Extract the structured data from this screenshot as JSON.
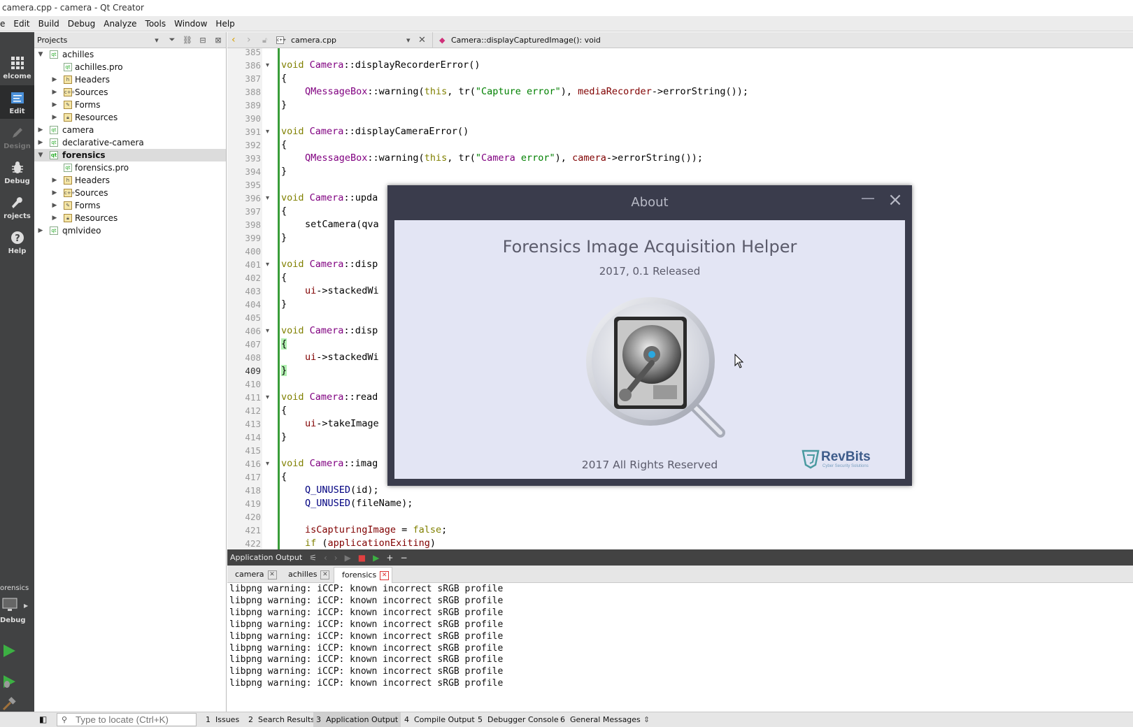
{
  "window": {
    "title": "camera.cpp - camera - Qt Creator"
  },
  "menu": [
    "e",
    "Edit",
    "Build",
    "Debug",
    "Analyze",
    "Tools",
    "Window",
    "Help"
  ],
  "modes": [
    {
      "label": "elcome",
      "icon": "grid-icon"
    },
    {
      "label": "Edit",
      "icon": "edit-icon"
    },
    {
      "label": "Design",
      "icon": "pencil-icon"
    },
    {
      "label": "Debug",
      "icon": "bug-icon"
    },
    {
      "label": "rojects",
      "icon": "wrench-icon"
    },
    {
      "label": "Help",
      "icon": "help-icon"
    }
  ],
  "kit": {
    "project": "orensics",
    "label": "Debug"
  },
  "projects": {
    "title": "Projects",
    "tree": [
      {
        "label": "achilles",
        "icon": "pro",
        "expanded": true
      },
      {
        "label": "achilles.pro",
        "icon": "profile"
      },
      {
        "label": "Headers",
        "icon": "h"
      },
      {
        "label": "Sources",
        "icon": "cpp"
      },
      {
        "label": "Forms",
        "icon": "form"
      },
      {
        "label": "Resources",
        "icon": "lock"
      },
      {
        "label": "camera",
        "icon": "pro"
      },
      {
        "label": "declarative-camera",
        "icon": "pro"
      },
      {
        "label": "forensics",
        "icon": "pro",
        "expanded": true,
        "selected": true
      },
      {
        "label": "forensics.pro",
        "icon": "profile"
      },
      {
        "label": "Headers",
        "icon": "h"
      },
      {
        "label": "Sources",
        "icon": "cpp"
      },
      {
        "label": "Forms",
        "icon": "form"
      },
      {
        "label": "Resources",
        "icon": "lock"
      },
      {
        "label": "qmlvideo",
        "icon": "pro"
      }
    ]
  },
  "editor": {
    "file": "camera.cpp",
    "function": "Camera::displayCapturedImage(): void",
    "current_line": "409",
    "line_numbers": [
      "385",
      "386",
      "387",
      "388",
      "389",
      "390",
      "391",
      "392",
      "393",
      "394",
      "395",
      "396",
      "397",
      "398",
      "399",
      "400",
      "401",
      "402",
      "403",
      "404",
      "405",
      "406",
      "407",
      "408",
      "409",
      "410",
      "411",
      "412",
      "413",
      "414",
      "415",
      "416",
      "417",
      "418",
      "419",
      "420",
      "421",
      "422"
    ],
    "code": {
      "l386": "void Camera::displayRecorderError()",
      "brace_open": "{",
      "brace_close": "}",
      "l388": "QMessageBox::warning(this, tr(\"Capture error\"), mediaRecorder->errorString());",
      "l391": "void Camera::displayCameraError()",
      "l393": "QMessageBox::warning(this, tr(\"Camera error\"), camera->errorString());",
      "l396": "void Camera::upda",
      "l398": "setCamera(qva",
      "l401": "void Camera::disp",
      "l403": "ui->stackedWi",
      "l406": "void Camera::disp",
      "l408": "ui->stackedWi",
      "l411": "void Camera::read",
      "l413": "ui->takeImage",
      "l416": "void Camera::imag",
      "l418": "Q_UNUSED(id);",
      "l419": "Q_UNUSED(fileName);",
      "l421": "isCapturingImage = false;",
      "l422": "if (applicationExiting)"
    }
  },
  "output": {
    "title": "Application Output",
    "tabs": [
      {
        "label": "camera"
      },
      {
        "label": "achilles"
      },
      {
        "label": "forensics",
        "active": true
      }
    ],
    "lines": [
      "libpng warning: iCCP: known incorrect sRGB profile",
      "libpng warning: iCCP: known incorrect sRGB profile",
      "libpng warning: iCCP: known incorrect sRGB profile",
      "libpng warning: iCCP: known incorrect sRGB profile",
      "libpng warning: iCCP: known incorrect sRGB profile",
      "libpng warning: iCCP: known incorrect sRGB profile",
      "libpng warning: iCCP: known incorrect sRGB profile",
      "libpng warning: iCCP: known incorrect sRGB profile",
      "libpng warning: iCCP: known incorrect sRGB profile"
    ]
  },
  "statusbar": {
    "locate_placeholder": "Type to locate (Ctrl+K)",
    "panes": [
      {
        "num": "1",
        "label": "Issues"
      },
      {
        "num": "2",
        "label": "Search Results"
      },
      {
        "num": "3",
        "label": "Application Output"
      },
      {
        "num": "4",
        "label": "Compile Output"
      },
      {
        "num": "5",
        "label": "Debugger Console"
      },
      {
        "num": "6",
        "label": "General Messages"
      }
    ]
  },
  "about": {
    "title": "About",
    "app_name": "Forensics Image Acquisition Helper",
    "version": "2017, 0.1 Released",
    "rights": "2017 All Rights Reserved",
    "logo_text": "RevBits",
    "logo_tagline": "Cyber Security Solutions"
  },
  "colors": {
    "accent_green": "#3a9d3a",
    "dialog_frame": "#3a3c4c",
    "dialog_body": "#e3e5f4",
    "mode_bar": "#414243"
  }
}
